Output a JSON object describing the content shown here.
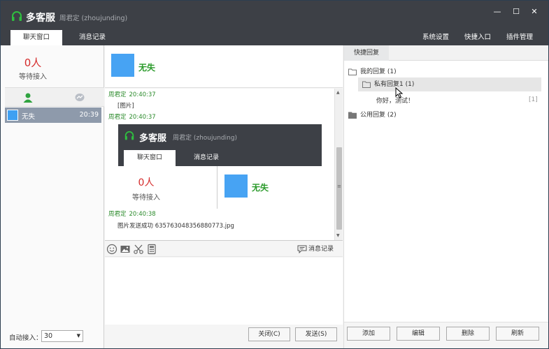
{
  "header": {
    "app_title": "多客服",
    "user": "周君定 (zhoujunding)",
    "tabs": [
      "聊天窗口",
      "消息记录"
    ],
    "nav": [
      "系统设置",
      "快捷入口",
      "插件管理"
    ],
    "window_controls": {
      "minimize": "—",
      "maximize": "☐",
      "close": "✕"
    }
  },
  "left": {
    "wait_count": "0人",
    "wait_label": "等待接入",
    "session": {
      "name": "无失",
      "time": "20:39"
    },
    "auto_label": "自动接入：",
    "auto_value": "30",
    "caret": "▼"
  },
  "chat": {
    "customer_name": "无失",
    "messages": [
      {
        "sender": "周君定",
        "time": "20:40:37",
        "text": "[图片]"
      },
      {
        "sender": "周君定",
        "time": "20:40:37",
        "text": ""
      },
      {
        "sender": "周君定",
        "time": "20:40:38",
        "text": "图片发送成功 635763048356880773.jpg"
      }
    ],
    "embedded": {
      "app_title": "多客服",
      "user": "周君定 (zhoujunding)",
      "tab_chat": "聊天窗口",
      "tab_history": "消息记录",
      "wait_count": "0人",
      "wait_label": "等待接入",
      "customer_name": "无失"
    },
    "scroll": {
      "up": "▲",
      "grip": "≡",
      "down": "▼"
    },
    "history_label": "消息记录",
    "close_label": "关闭(C)",
    "send_label": "发送(S)"
  },
  "quick_reply": {
    "tab": "快捷回复",
    "tree": [
      {
        "label": "我的回复 (1)"
      },
      {
        "label": "私有回复1 (1)"
      },
      {
        "label": "你好，测试！",
        "count": "[1]"
      },
      {
        "label": "公用回复 (2)"
      }
    ],
    "buttons": [
      "添加",
      "编辑",
      "删除",
      "刷新"
    ]
  },
  "colors": {
    "titlebar": "#3d4046",
    "accent_green": "#2a9a2a",
    "alert_red": "#d52b2b",
    "avatar_blue": "#47a3f3"
  }
}
